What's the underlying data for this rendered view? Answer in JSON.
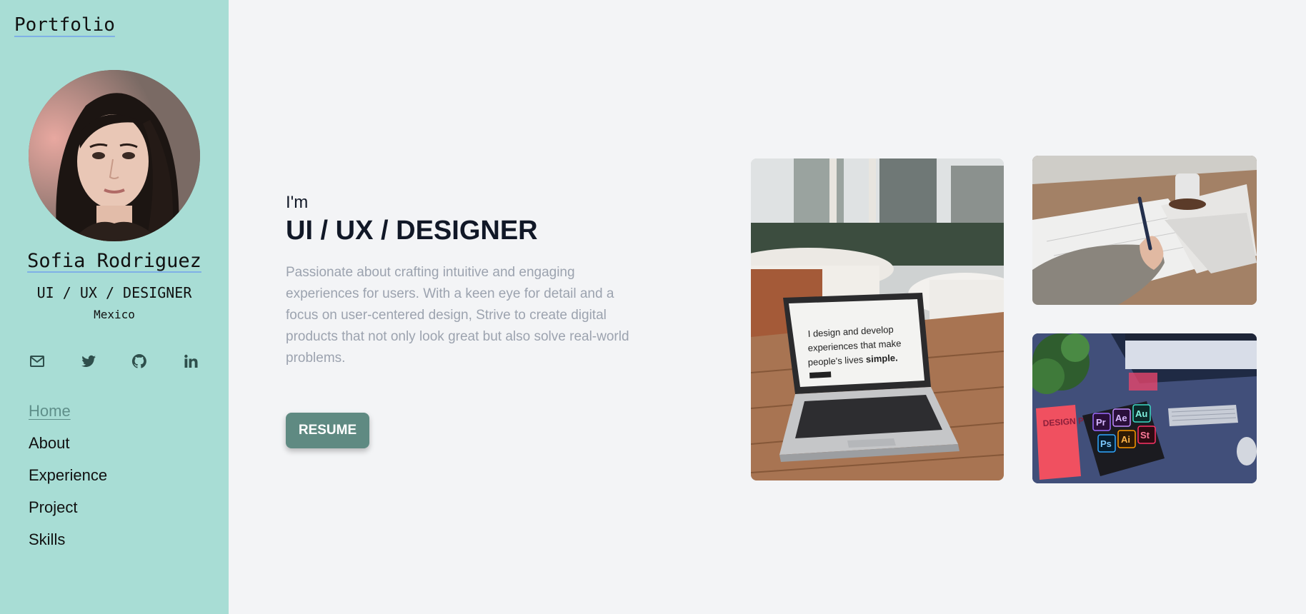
{
  "brand": "Portfolio",
  "profile": {
    "name": "Sofia Rodriguez",
    "role": "UI / UX / DESIGNER",
    "location": "Mexico"
  },
  "socials": [
    {
      "name": "mail-icon"
    },
    {
      "name": "twitter-icon"
    },
    {
      "name": "github-icon"
    },
    {
      "name": "linkedin-icon"
    }
  ],
  "nav": {
    "items": [
      "Home",
      "About",
      "Experience",
      "Project",
      "Skills"
    ],
    "active": "Home"
  },
  "hero": {
    "intro": "I'm",
    "headline": "UI / UX / DESIGNER",
    "description": "Passionate about crafting intuitive and engaging experiences for users. With a keen eye for detail and a focus on user-centered design, Strive to create digital products that not only look great but also solve real-world problems.",
    "resume_label": "RESUME"
  },
  "photos": {
    "laptop_screen_text_1": "I design and develop",
    "laptop_screen_text_2": "experiences that make",
    "laptop_screen_text_3": "people's lives",
    "laptop_screen_text_bold": "simple.",
    "notebook_text": "DESIGN PLAY BOOK",
    "app_tiles": [
      "Pr",
      "Ae",
      "Au",
      "Ps",
      "Ai",
      "St"
    ]
  },
  "colors": {
    "sidebar_bg": "#a8ddd5",
    "page_bg": "#f3f4f6",
    "accent": "#5f8a82",
    "underline": "#7fb0e6",
    "description_text": "#9ca3af"
  }
}
